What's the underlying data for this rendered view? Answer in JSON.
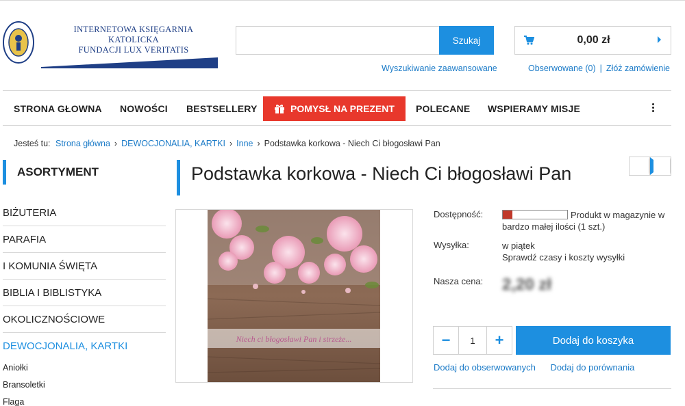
{
  "header": {
    "logo_seal_text": "LUX VERITATIS",
    "logo_line1": "INTERNETOWA KSIĘGARNIA KATOLICKA",
    "logo_line2": "FUNDACJI LUX VERITATIS",
    "search": {
      "placeholder": "",
      "button_label": "Szukaj",
      "advanced_label": "Wyszukiwanie zaawansowane"
    },
    "cart": {
      "total": "0,00 zł",
      "icon": "cart-icon"
    },
    "user_links": {
      "watched": "Obserwowane (0)",
      "separator": "|",
      "order": "Złóż zamówienie"
    }
  },
  "nav": {
    "items": [
      "STRONA GŁOWNA",
      "NOWOŚCI",
      "BESTSELLERY"
    ],
    "gift_label": "POMYSŁ NA PREZENT",
    "items_after": [
      "POLECANE",
      "WSPIERAMY MISJE"
    ],
    "more_icon": "kebab-menu-icon"
  },
  "breadcrumb": {
    "prefix": "Jesteś tu:",
    "links": [
      "Strona główna",
      "DEWOCJONALIA, KARTKI",
      "Inne"
    ],
    "current": "Podstawka korkowa - Niech Ci błogosławi Pan"
  },
  "sidebar": {
    "title": "ASORTYMENT",
    "categories": [
      "BIŻUTERIA",
      "PARAFIA",
      "I KOMUNIA ŚWIĘTA",
      "BIBLIA I BIBLISTYKA",
      "OKOLICZNOŚCIOWE",
      "DEWOCJONALIA, KARTKI"
    ],
    "active_index": 5,
    "subcategories": [
      "Aniołki",
      "Bransoletki",
      "Flaga"
    ]
  },
  "product": {
    "title": "Podstawka korkowa - Niech Ci błogosławi Pan",
    "image_caption": "Niech ci błogosławi Pan i strzeże...",
    "availability_label": "Dostępność:",
    "availability_level": 0.15,
    "availability_text": "Produkt w magazynie w bardzo małej ilości (1 szt.)",
    "shipping_label": "Wysyłka:",
    "shipping_value": "w piątek",
    "shipping_link": "Sprawdź czasy i koszty wysyłki",
    "price_label": "Nasza cena:",
    "price_value": "2,20 zł",
    "quantity": "1",
    "add_to_cart": "Dodaj do koszyka",
    "watch_link": "Dodaj do obserwowanych",
    "compare_link": "Dodaj do porównania"
  },
  "colors": {
    "accent": "#1d8fe0",
    "gift": "#e8382c",
    "stock": "#c0392b"
  }
}
